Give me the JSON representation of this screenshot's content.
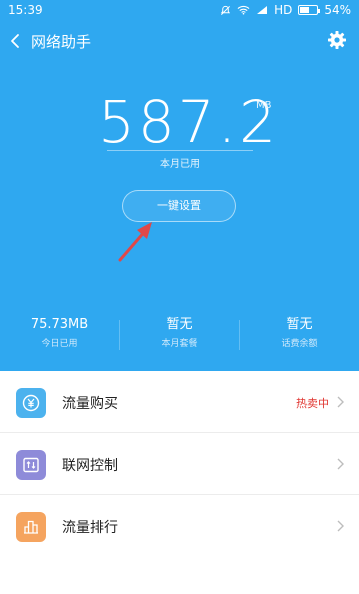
{
  "status_bar": {
    "time": "15:39",
    "network": "HD",
    "battery": "54%",
    "battery_level": 0.54
  },
  "header": {
    "title": "网络助手",
    "back_icon": "chevron-left-icon",
    "settings_icon": "gear-icon"
  },
  "usage": {
    "value": "587.2",
    "unit": "MB",
    "label": "本月已用"
  },
  "onekey_button": {
    "label": "一键设置"
  },
  "stats": [
    {
      "value": "75.73MB",
      "caption": "今日已用"
    },
    {
      "value": "暂无",
      "caption": "本月套餐"
    },
    {
      "value": "暂无",
      "caption": "话费余额"
    }
  ],
  "list": [
    {
      "label": "流量购买",
      "badge": "热卖中",
      "icon": "yen-coin-icon",
      "color": "#4cb2ee"
    },
    {
      "label": "联网控制",
      "badge": "",
      "icon": "network-control-icon",
      "color": "#8e8bd9"
    },
    {
      "label": "流量排行",
      "badge": "",
      "icon": "bar-chart-icon",
      "color": "#f5a45f"
    }
  ],
  "colors": {
    "hero_bg": "#2fa8f0",
    "badge_red": "#e0342f",
    "arrow_red": "#e04848"
  }
}
